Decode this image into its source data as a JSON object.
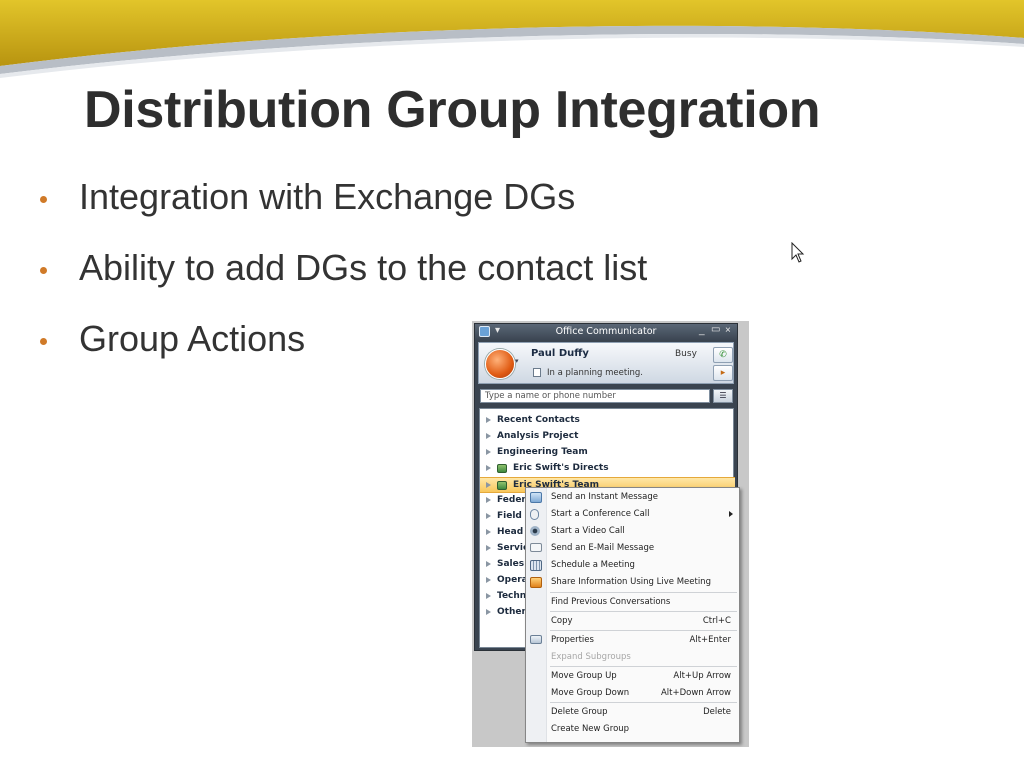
{
  "slide": {
    "title": "Distribution Group Integration",
    "bullets": [
      "Integration with Exchange DGs",
      "Ability to add DGs to the contact list",
      "Group Actions"
    ]
  },
  "colors": {
    "banner_gold": "#d2b322",
    "bullet_orange": "#d07a28",
    "title_text": "#2e2e2e",
    "selected_group": "#f8c75c"
  },
  "communicator": {
    "window_title": "Office Communicator",
    "user_name": "Paul Duffy",
    "presence": "Busy",
    "note": "In a planning meeting.",
    "search_placeholder": "Type a name or phone number",
    "groups": [
      {
        "label": "Recent Contacts",
        "dg": false,
        "selected": false
      },
      {
        "label": "Analysis Project",
        "dg": false,
        "selected": false
      },
      {
        "label": "Engineering Team",
        "dg": false,
        "selected": false
      },
      {
        "label": "Eric Swift's Directs",
        "dg": true,
        "selected": false
      },
      {
        "label": "Eric Swift's Team",
        "dg": true,
        "selected": true
      },
      {
        "label": "Federat",
        "dg": false,
        "selected": false
      },
      {
        "label": "Field",
        "dg": false,
        "selected": false
      },
      {
        "label": "Head O",
        "dg": false,
        "selected": false
      },
      {
        "label": "Service",
        "dg": false,
        "selected": false
      },
      {
        "label": "Sales T",
        "dg": false,
        "selected": false
      },
      {
        "label": "Operati",
        "dg": false,
        "selected": false
      },
      {
        "label": "Technic",
        "dg": false,
        "selected": false
      },
      {
        "label": "Other C",
        "dg": false,
        "selected": false
      }
    ],
    "context_menu": [
      {
        "label": "Send an Instant Message",
        "shortcut": "",
        "icon": "im-icon",
        "disabled": false,
        "submenu": false
      },
      {
        "label": "Start a Conference Call",
        "shortcut": "",
        "icon": "phone-icon",
        "disabled": false,
        "submenu": true
      },
      {
        "label": "Start a Video Call",
        "shortcut": "",
        "icon": "webcam-icon",
        "disabled": false,
        "submenu": false
      },
      {
        "label": "Send an E-Mail Message",
        "shortcut": "",
        "icon": "email-icon",
        "disabled": false,
        "submenu": false
      },
      {
        "label": "Schedule a Meeting",
        "shortcut": "",
        "icon": "calendar-icon",
        "disabled": false,
        "submenu": false
      },
      {
        "label": "Share Information Using Live Meeting",
        "shortcut": "",
        "icon": "live-meeting-icon",
        "disabled": false,
        "submenu": false
      },
      {
        "label": "Find Previous Conversations",
        "shortcut": "",
        "icon": "",
        "disabled": false,
        "submenu": false
      },
      {
        "label": "Copy",
        "shortcut": "Ctrl+C",
        "icon": "",
        "disabled": false,
        "submenu": false
      },
      {
        "label": "Properties",
        "shortcut": "Alt+Enter",
        "icon": "properties-icon",
        "disabled": false,
        "submenu": false
      },
      {
        "label": "Expand Subgroups",
        "shortcut": "",
        "icon": "",
        "disabled": true,
        "submenu": false
      },
      {
        "label": "Move Group Up",
        "shortcut": "Alt+Up Arrow",
        "icon": "",
        "disabled": false,
        "submenu": false
      },
      {
        "label": "Move Group Down",
        "shortcut": "Alt+Down Arrow",
        "icon": "",
        "disabled": false,
        "submenu": false
      },
      {
        "label": "Delete Group",
        "shortcut": "Delete",
        "icon": "",
        "disabled": false,
        "submenu": false
      },
      {
        "label": "Create New Group",
        "shortcut": "",
        "icon": "",
        "disabled": false,
        "submenu": false
      }
    ]
  }
}
